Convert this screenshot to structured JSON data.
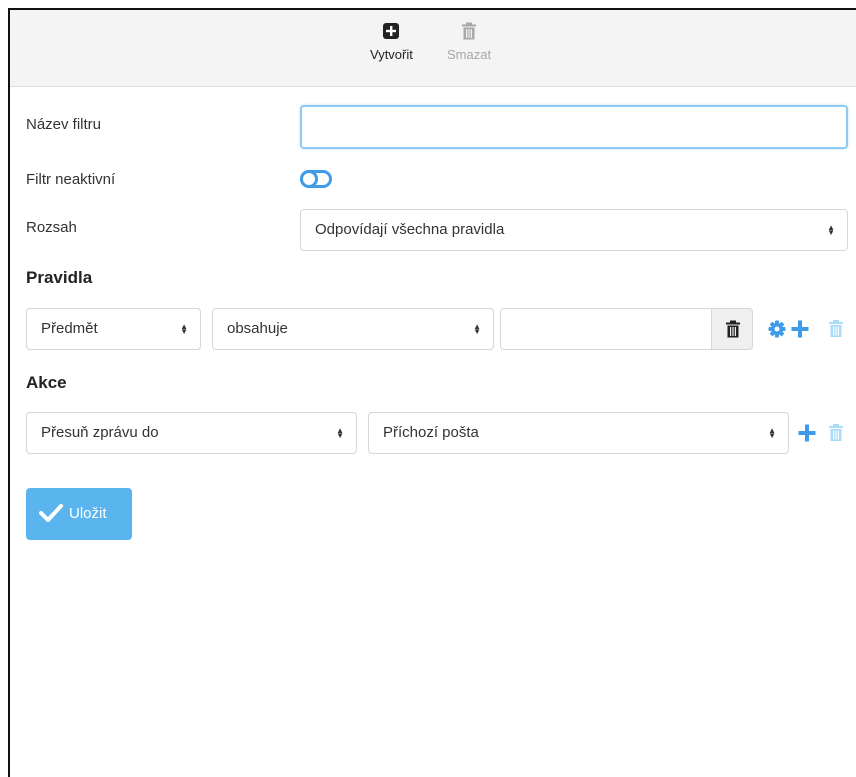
{
  "toolbar": {
    "create_label": "Vytvořit",
    "delete_label": "Smazat"
  },
  "form": {
    "filter_name_label": "Název filtru",
    "filter_name_value": "",
    "inactive_label": "Filtr neaktivní",
    "scope_label": "Rozsah",
    "scope_value": "Odpovídají všechna pravidla"
  },
  "rules": {
    "heading": "Pravidla",
    "items": [
      {
        "field": "Předmět",
        "operator": "obsahuje",
        "value": ""
      }
    ]
  },
  "actions": {
    "heading": "Akce",
    "items": [
      {
        "action": "Přesuň zprávu do",
        "target": "Příchozí pošta"
      }
    ]
  },
  "save_label": "Uložit",
  "colors": {
    "accent": "#3d9be9",
    "save_button": "#5ab4ee",
    "disabled_icon": "#a8dcf7"
  }
}
